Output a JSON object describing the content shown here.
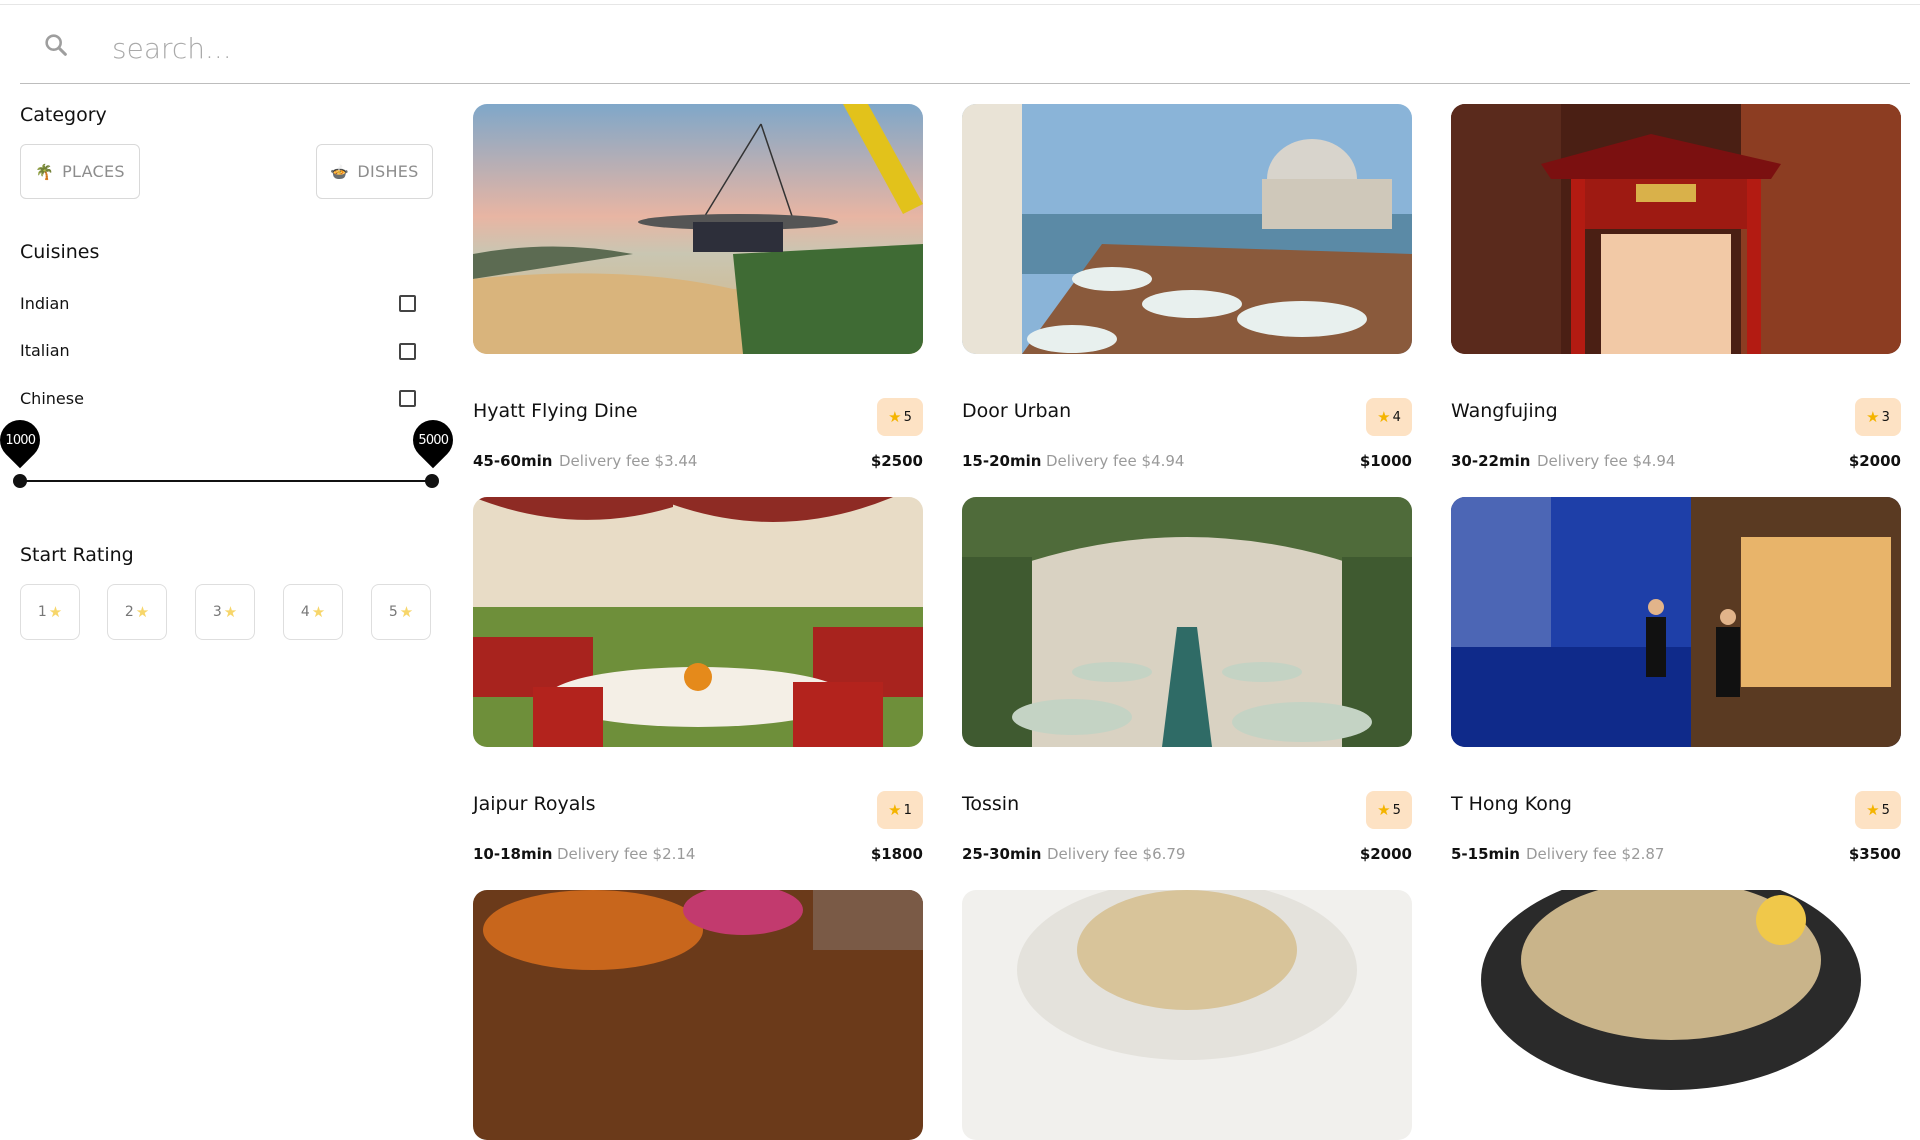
{
  "search": {
    "placeholder": "search..."
  },
  "sidebar": {
    "category_heading": "Category",
    "categories": [
      {
        "label": "PLACES",
        "icon": "palm-tree-icon"
      },
      {
        "label": "DISHES",
        "icon": "food-bowl-icon"
      }
    ],
    "cuisines_heading": "Cuisines",
    "cuisines": [
      {
        "label": "Indian",
        "checked": false
      },
      {
        "label": "Italian",
        "checked": false
      },
      {
        "label": "Chinese",
        "checked": false
      }
    ],
    "price_range": {
      "min": "1000",
      "max": "5000"
    },
    "rating_heading": "Start Rating",
    "ratings": [
      "1",
      "2",
      "3",
      "4",
      "5"
    ]
  },
  "cards": [
    {
      "name": "Hyatt Flying Dine",
      "rating": "5",
      "time": "45-60min",
      "fee": "Delivery fee $3.44",
      "price": "$2500"
    },
    {
      "name": "Door Urban",
      "rating": "4",
      "time": "15-20min",
      "fee": "Delivery fee $4.94",
      "price": "$1000"
    },
    {
      "name": "Wangfujing",
      "rating": "3",
      "time": "30-22min",
      "fee": "Delivery fee $4.94",
      "price": "$2000"
    },
    {
      "name": "Jaipur Royals",
      "rating": "1",
      "time": "10-18min",
      "fee": "Delivery fee $2.14",
      "price": "$1800"
    },
    {
      "name": "Tossin",
      "rating": "5",
      "time": "25-30min",
      "fee": "Delivery fee $6.79",
      "price": "$2000"
    },
    {
      "name": "T Hong Kong",
      "rating": "5",
      "time": "5-15min",
      "fee": "Delivery fee $2.87",
      "price": "$3500"
    }
  ],
  "colors": {
    "rating_badge": "#fde2c4",
    "star": "#f4b400",
    "slider": "#000000"
  }
}
